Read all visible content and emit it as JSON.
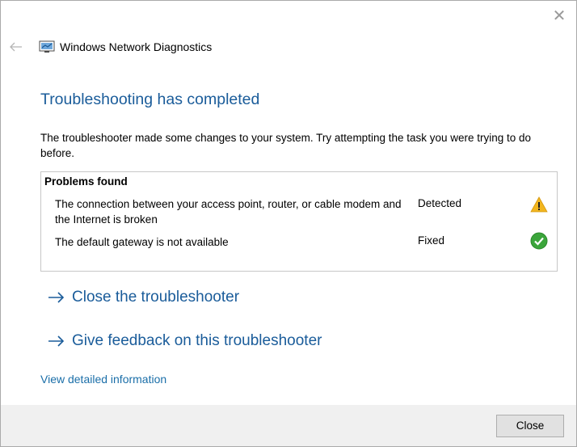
{
  "window": {
    "title": "Windows Network Diagnostics",
    "close_glyph": "✕"
  },
  "heading": "Troubleshooting has completed",
  "description": "The troubleshooter made some changes to your system. Try attempting the task you were trying to do before.",
  "problems": {
    "title": "Problems found",
    "items": [
      {
        "description": "The connection between your access point, router, or cable modem and the Internet is broken",
        "status": "Detected",
        "icon": "warning-icon"
      },
      {
        "description": "The default gateway is not available",
        "status": "Fixed",
        "icon": "check-icon"
      }
    ]
  },
  "actions": {
    "close_troubleshooter": "Close the troubleshooter",
    "give_feedback": "Give feedback on this troubleshooter"
  },
  "detail_link": "View detailed information",
  "footer": {
    "close_button": "Close"
  },
  "colors": {
    "heading": "#1a5c9a",
    "link": "#1a6ea8",
    "warning": "#f2b61f",
    "success": "#3ba53b",
    "footer_bg": "#f0f0f0"
  }
}
